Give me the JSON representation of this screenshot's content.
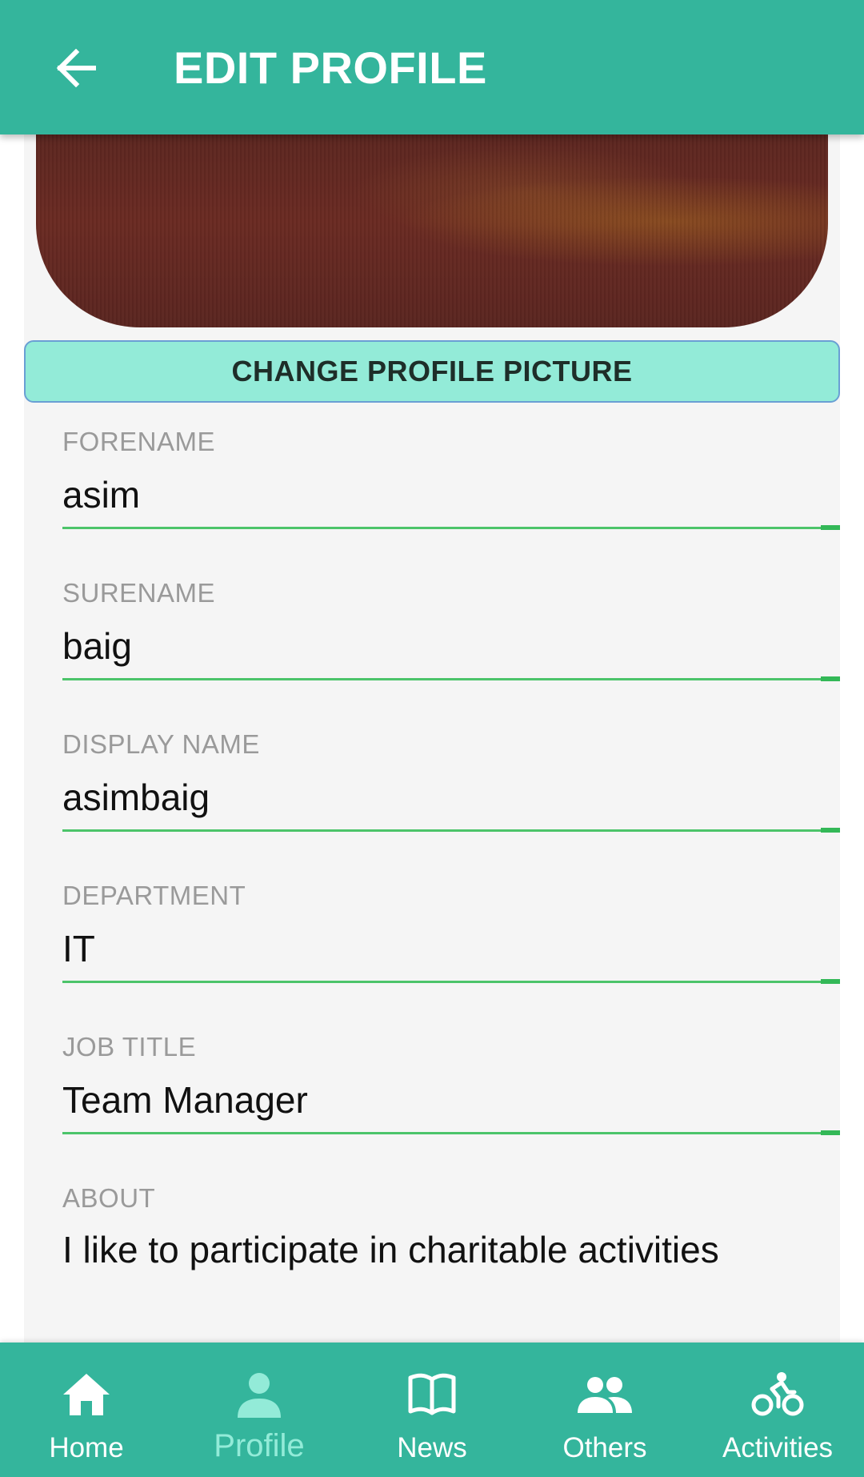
{
  "app_bar": {
    "title": "EDIT PROFILE",
    "back_icon": "arrow-left-icon"
  },
  "profile": {
    "change_picture_label": "CHANGE PROFILE PICTURE"
  },
  "fields": [
    {
      "label": "FORENAME",
      "value": "asim"
    },
    {
      "label": "SURENAME",
      "value": "baig"
    },
    {
      "label": "DISPLAY NAME",
      "value": "asimbaig"
    },
    {
      "label": "DEPARTMENT",
      "value": "IT"
    },
    {
      "label": "JOB TITLE",
      "value": "Team Manager"
    },
    {
      "label": "ABOUT",
      "value": "I like to participate in charitable activities"
    }
  ],
  "bottom_nav": {
    "items": [
      {
        "label": "Home",
        "icon": "home-icon",
        "active": false
      },
      {
        "label": "Profile",
        "icon": "person-icon",
        "active": true
      },
      {
        "label": "News",
        "icon": "book-icon",
        "active": false
      },
      {
        "label": "Others",
        "icon": "people-icon",
        "active": false
      },
      {
        "label": "Activities",
        "icon": "bicycle-icon",
        "active": false
      }
    ]
  },
  "colors": {
    "primary": "#34b59c",
    "accent_light": "#93ebd8",
    "underline": "#4cc46a",
    "background": "#f5f5f5"
  }
}
